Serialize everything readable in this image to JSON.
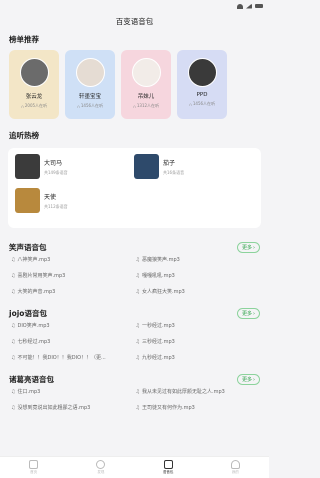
{
  "app": {
    "title": "百变语音包"
  },
  "ranking": {
    "title": "榜单推荐",
    "items": [
      {
        "name": "张云龙",
        "count": "2005人在听",
        "bg": "#f3e6c7",
        "avatar": "#6b6b6b"
      },
      {
        "name": "轩墨宝宝",
        "count": "1456人在听",
        "bg": "#cfe0f6",
        "avatar": "#e5dcd3"
      },
      {
        "name": "吊妹儿",
        "count": "1312人在听",
        "bg": "#f6d6de",
        "avatar": "#f2ece8"
      },
      {
        "name": "PPD",
        "count": "1456人在听",
        "bg": "#d6dcf4",
        "avatar": "#3a3a3a"
      }
    ]
  },
  "chase": {
    "title": "追听热榜",
    "items": [
      {
        "name": "大司马",
        "count": "共149条语音",
        "thumb": "#3b3b3b"
      },
      {
        "name": "茄子",
        "count": "共16条语音",
        "thumb": "#2e4a6b"
      },
      {
        "name": "天使",
        "count": "共112条语音",
        "thumb": "#b8893d"
      }
    ]
  },
  "sections": [
    {
      "title": "笑声语音包",
      "more": "更多",
      "tracks": [
        "八神笑声.mp3",
        "恶魔狼笑声.mp3",
        "喜剧片常用笑声.mp3",
        "嘎嘎吼吼.mp3",
        "大笑的声音.mp3",
        "女人疯狂大笑.mp3"
      ]
    },
    {
      "title": "jojo语音包",
      "more": "更多",
      "tracks": [
        "DIO笑声.mp3",
        "一秒经过.mp3",
        "七秒经过.mp3",
        "三秒经过.mp3",
        "不可能！！我DIO！！我DIO！！（更...",
        "九秒经过.mp3"
      ]
    },
    {
      "title": "诸葛亮语音包",
      "more": "更多",
      "tracks": [
        "住口.mp3",
        "我从未见过有如此厚颜无耻之人.mp3",
        "没想到竟说出如此粗鄙之语.mp3",
        "王司徒又有何作为.mp3"
      ]
    }
  ],
  "nav": {
    "items": [
      {
        "label": "首页",
        "active": false
      },
      {
        "label": "发现",
        "active": false
      },
      {
        "label": "语音包",
        "active": true
      },
      {
        "label": "我的",
        "active": false
      }
    ]
  }
}
